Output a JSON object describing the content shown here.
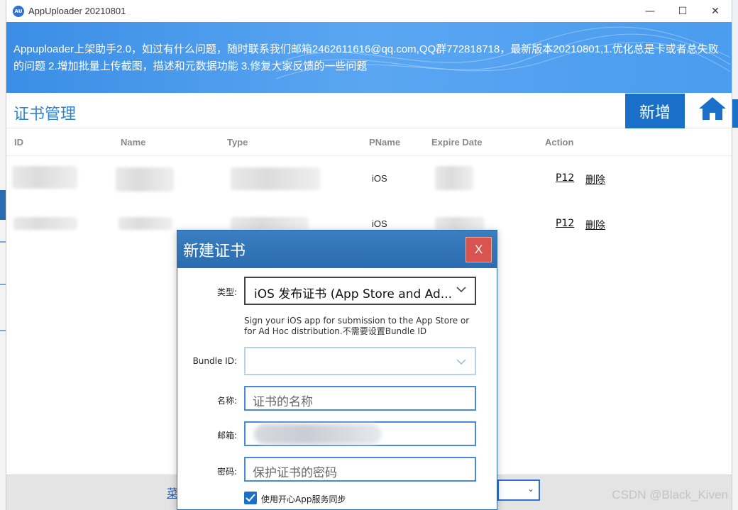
{
  "window": {
    "title": "AppUploader 20210801",
    "logo_text": "AU",
    "controls": {
      "minimize": "—",
      "maximize": "☐",
      "close": "✕"
    }
  },
  "banner": {
    "text": "Appuploader上架助手2.0，如过有什么问题，随时联系我们邮箱2462611616@qq.com,QQ群772818718，最新版本20210801,1.优化总是卡或者总失败的问题 2.增加批量上传截图，描述和元数据功能 3.修复大家反馈的一些问题"
  },
  "toolbar": {
    "title": "证书管理",
    "add_label": "新增",
    "home_icon": "home-icon"
  },
  "table": {
    "headers": [
      "ID",
      "Name",
      "Type",
      "PName",
      "Expire Date",
      "Action"
    ],
    "rows": [
      {
        "pname": "iOS",
        "action_p12": "P12",
        "action_delete": "删除"
      },
      {
        "pname": "iOS",
        "action_p12": "P12",
        "action_delete": "删除"
      }
    ]
  },
  "bottom": {
    "link_text": "菜"
  },
  "dialog": {
    "title": "新建证书",
    "close_label": "X",
    "type_label": "类型:",
    "type_value": "iOS 发布证书 (App Store and Ad...",
    "hint": "Sign your iOS app for submission to the App Store or for Ad Hoc distribution.不需要设置Bundle ID",
    "bundle_label": "Bundle ID:",
    "name_label": "名称:",
    "name_placeholder": "证书的名称",
    "email_label": "邮箱:",
    "password_label": "密码:",
    "password_placeholder": "保护证书的密码",
    "sync_label": "使用开心App服务同步",
    "sync_checked": true
  },
  "watermark": "CSDN @Black_Kiven",
  "colors": {
    "accent": "#1a6fc9",
    "banner": "#4a9cef",
    "title_blue": "#2a86d6",
    "close_red": "#d9534f"
  }
}
